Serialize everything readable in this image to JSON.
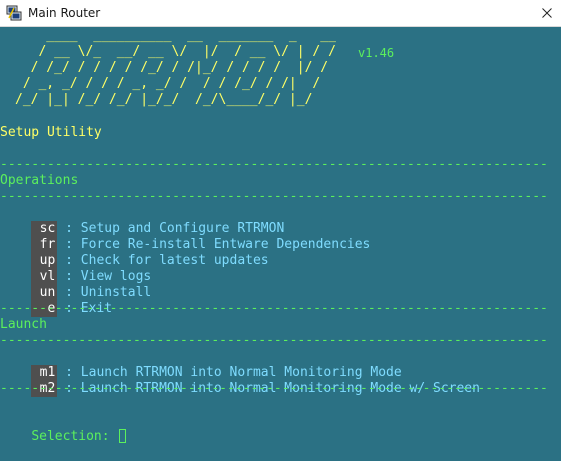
{
  "window": {
    "title": "Main Router",
    "app_icon": "putty-icon",
    "close_icon": "close-icon"
  },
  "banner": {
    "lines": [
      "    ____  __________  __  _______  _   __",
      "   / __ \\/_  __/ __ \\/  |/  / __ \\/ | / /",
      "  / /_/ / / / / /_/ / /|_/ / / / /  |/ /",
      " / _, _/ / / / _, _/ /  / / /_/ / /|  /",
      "/_/ |_| /_/ /_/ |_/_/  /_/\\____/_/ |_/"
    ],
    "version": "v1.46"
  },
  "subtitle": "Setup Utility",
  "divider": "----------------------------------------------------------------------",
  "operations": {
    "heading": "Operations",
    "items": [
      {
        "key": "sc",
        "label": "Setup and Configure RTRMON"
      },
      {
        "key": "fr",
        "label": "Force Re-install Entware Dependencies"
      },
      {
        "key": "up",
        "label": "Check for latest updates"
      },
      {
        "key": "vl",
        "label": "View logs"
      },
      {
        "key": "un",
        "label": "Uninstall"
      },
      {
        "key": "e",
        "label": "Exit"
      }
    ]
  },
  "launch": {
    "heading": "Launch",
    "items": [
      {
        "key": "m1",
        "label": "Launch RTRMON into Normal Monitoring Mode"
      },
      {
        "key": "m2",
        "label": "Launch RTRMON into Normal Monitoring Mode w/ Screen"
      }
    ]
  },
  "item_separator": " : ",
  "prompt": {
    "label": "Selection: ",
    "value": ""
  },
  "colors": {
    "background": "#2b7184",
    "banner": "#ffff66",
    "heading": "#5cf05c",
    "item_text": "#7fdcff",
    "key_bg": "#4f4f4f"
  }
}
